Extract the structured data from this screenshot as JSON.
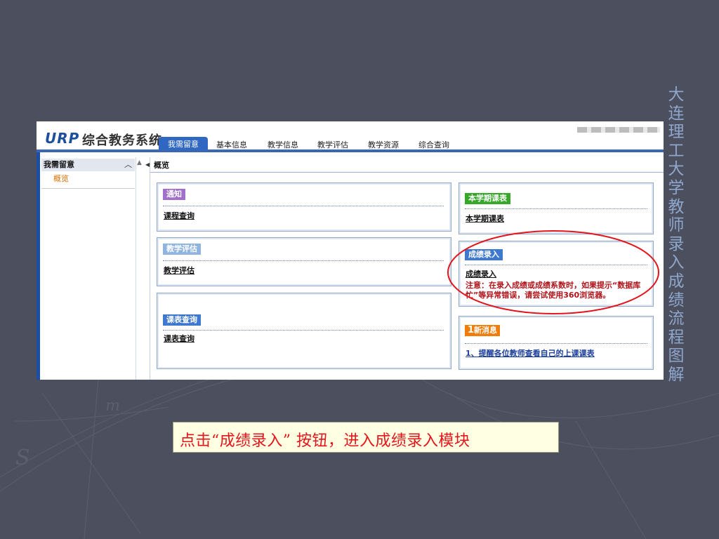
{
  "slide": {
    "side_title": "大连理工大学教师录入成绩流程图解",
    "caption": "点击“成绩录入” 按钮，进入成绩录入模块",
    "colors": {
      "background": "#4b4f5e",
      "side_title": "#8fa6cc",
      "caption": "#e4141b",
      "highlight_ellipse": "#e4141b"
    }
  },
  "app": {
    "logo_urp": "URP",
    "logo_name": "综合教务系统",
    "tabs": [
      {
        "label": "我需留意",
        "active": true
      },
      {
        "label": "基本信息",
        "active": false
      },
      {
        "label": "教学信息",
        "active": false
      },
      {
        "label": "教学评估",
        "active": false
      },
      {
        "label": "教学资源",
        "active": false
      },
      {
        "label": "综合查询",
        "active": false
      }
    ],
    "sidebar": {
      "header": "我需留意",
      "header_icon": "chevron-up-icon",
      "items": [
        {
          "label": "概览"
        }
      ]
    },
    "breadcrumb": "概览",
    "panels": {
      "notice": {
        "tag": "通知",
        "link": "课程查询",
        "tag_color": "#a070cc"
      },
      "eval": {
        "tag": "教学评估",
        "link": "教学评估",
        "tag_color": "#8fb4e0"
      },
      "schedule": {
        "tag": "课表查询",
        "link": "课表查询",
        "tag_color": "#3f79cf"
      },
      "semester": {
        "tag": "本学期课表",
        "link": "本学期课表",
        "tag_color": "#35a829"
      },
      "grades": {
        "tag": "成绩录入",
        "link": "成绩录入",
        "note": "注意：在录入成绩或成绩系数时，如果提示“数据库忙”等异常错误，请尝试使用360浏览器。",
        "tag_color": "#3f79cf"
      },
      "messages": {
        "badge_count": "1",
        "tag": "新消息",
        "item": "1、提醒各位教师查看自己的上课课表",
        "tag_color": "#f07d0a"
      }
    }
  }
}
